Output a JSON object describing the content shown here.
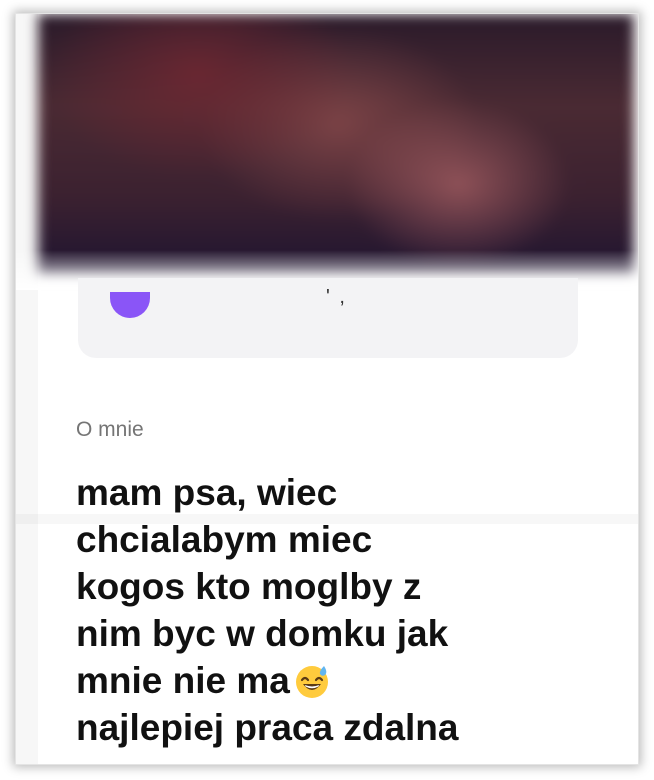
{
  "profile": {
    "card_text": "' ,"
  },
  "about": {
    "label": "O mnie",
    "bio_lines": [
      "mam psa, wiec",
      "chcialabym miec",
      "kogos kto moglby z",
      "nim byc w domku jak",
      "mnie nie ma",
      "najlepiej praca zdalna"
    ],
    "emoji_icon": "grinning-sweat-emoji"
  },
  "colors": {
    "accent": "#8a55f7",
    "label": "#757575",
    "text": "#111111",
    "card": "#f3f3f5"
  }
}
